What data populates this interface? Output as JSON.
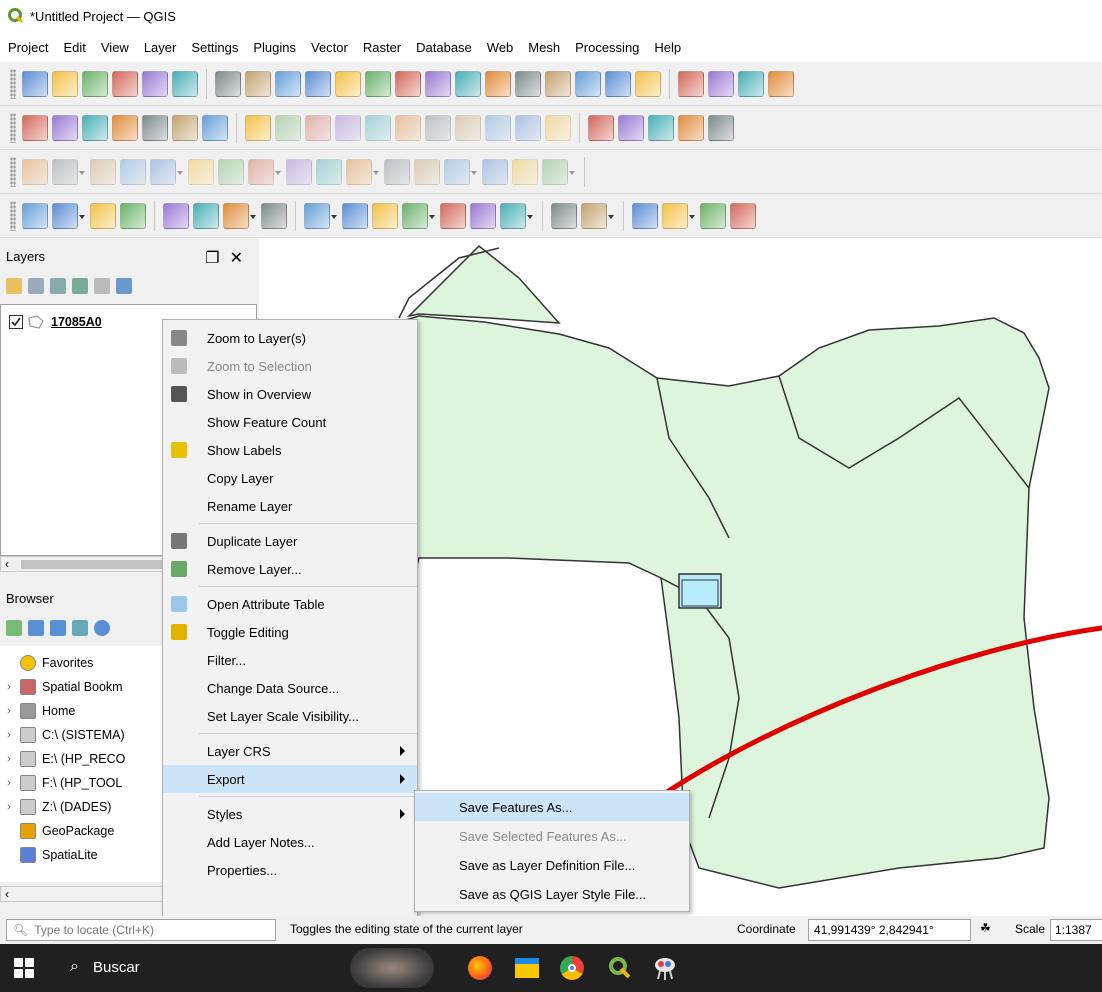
{
  "window": {
    "title": "*Untitled Project — QGIS"
  },
  "menubar": [
    "Project",
    "Edit",
    "View",
    "Layer",
    "Settings",
    "Plugins",
    "Vector",
    "Raster",
    "Database",
    "Web",
    "Mesh",
    "Processing",
    "Help"
  ],
  "layers_panel": {
    "title": "Layers",
    "layer_name": "17085A0",
    "layer_checked": true
  },
  "browser_panel": {
    "title": "Browser",
    "items": [
      {
        "label": "Favorites",
        "icon": "star-icon",
        "expandable": false
      },
      {
        "label": "Spatial Bookm",
        "icon": "bookmark-icon",
        "expandable": true
      },
      {
        "label": "Home",
        "icon": "home-folder-icon",
        "expandable": true
      },
      {
        "label": "C:\\ (SISTEMA)",
        "icon": "folder-icon",
        "expandable": true
      },
      {
        "label": "E:\\ (HP_RECO",
        "icon": "folder-icon",
        "expandable": true
      },
      {
        "label": "F:\\ (HP_TOOL",
        "icon": "folder-icon",
        "expandable": true
      },
      {
        "label": "Z:\\ (DADES)",
        "icon": "folder-icon",
        "expandable": true
      },
      {
        "label": "GeoPackage",
        "icon": "geopackage-icon",
        "expandable": false
      },
      {
        "label": "SpatiaLite",
        "icon": "spatialite-icon",
        "expandable": false
      }
    ]
  },
  "context_menu": {
    "items": [
      {
        "label": "Zoom to Layer(s)",
        "icon": "zoom-layer-icon",
        "disabled": false
      },
      {
        "label": "Zoom to Selection",
        "icon": "zoom-selection-icon",
        "disabled": true
      },
      {
        "label": "Show in Overview",
        "icon": "overview-icon",
        "disabled": false
      },
      {
        "label": "Show Feature Count",
        "icon": "",
        "disabled": false
      },
      {
        "label": "Show Labels",
        "icon": "labels-icon",
        "disabled": false
      },
      {
        "label": "Copy Layer",
        "icon": "",
        "disabled": false
      },
      {
        "label": "Rename Layer",
        "icon": "",
        "disabled": false
      },
      {
        "label": "Duplicate Layer",
        "icon": "duplicate-icon",
        "disabled": false
      },
      {
        "label": "Remove Layer...",
        "icon": "remove-layer-icon",
        "disabled": false
      },
      {
        "label": "Open Attribute Table",
        "icon": "table-icon",
        "disabled": false
      },
      {
        "label": "Toggle Editing",
        "icon": "pencil-icon",
        "disabled": false
      },
      {
        "label": "Filter...",
        "icon": "",
        "disabled": false
      },
      {
        "label": "Change Data Source...",
        "icon": "",
        "disabled": false
      },
      {
        "label": "Set Layer Scale Visibility...",
        "icon": "",
        "disabled": false
      },
      {
        "label": "Layer CRS",
        "icon": "",
        "disabled": false,
        "submenu": true
      },
      {
        "label": "Export",
        "icon": "",
        "disabled": false,
        "submenu": true,
        "highlighted": true
      },
      {
        "label": "Styles",
        "icon": "",
        "disabled": false,
        "submenu": true
      },
      {
        "label": "Add Layer Notes...",
        "icon": "",
        "disabled": false
      },
      {
        "label": "Properties...",
        "icon": "",
        "disabled": false
      }
    ]
  },
  "export_submenu": {
    "items": [
      {
        "label": "Save Features As...",
        "disabled": false,
        "highlighted": true
      },
      {
        "label": "Save Selected Features As...",
        "disabled": true
      },
      {
        "label": "Save as Layer Definition File...",
        "disabled": false
      },
      {
        "label": "Save as QGIS Layer Style File...",
        "disabled": false
      }
    ]
  },
  "statusbar": {
    "locator_placeholder": "Type to locate (Ctrl+K)",
    "message": "Toggles the editing state of the current layer",
    "coordinate_label": "Coordinate",
    "coordinate_value": "41,991439° 2,842941°",
    "scale_label": "Scale",
    "scale_value": "1:1387"
  },
  "taskbar": {
    "search_label": "Buscar"
  },
  "colors": {
    "polygon_fill": "#dcf5dc",
    "polygon_stroke": "#333333",
    "water_fill": "#b7ecfa",
    "annotation_arrow": "#e00000",
    "menu_highlight": "#cce4f7"
  }
}
